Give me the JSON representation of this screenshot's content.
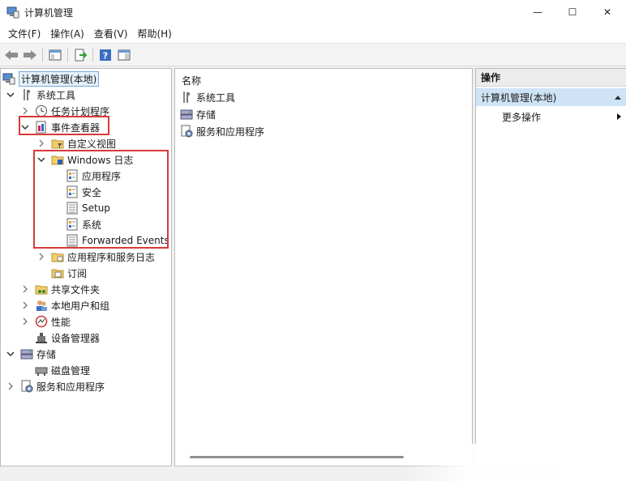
{
  "window": {
    "title": "计算机管理",
    "minimize": "—",
    "maximize": "☐",
    "close": "✕"
  },
  "menu": [
    "文件(F)",
    "操作(A)",
    "查看(V)",
    "帮助(H)"
  ],
  "tree": {
    "root": "计算机管理(本地)",
    "system_tools": "系统工具",
    "task_scheduler": "任务计划程序",
    "event_viewer": "事件查看器",
    "custom_views": "自定义视图",
    "windows_logs": "Windows 日志",
    "application": "应用程序",
    "security": "安全",
    "setup": "Setup",
    "system": "系统",
    "forwarded_events": "Forwarded Events",
    "app_service_logs": "应用程序和服务日志",
    "subscriptions": "订阅",
    "shared_folders": "共享文件夹",
    "local_users": "本地用户和组",
    "performance": "性能",
    "device_manager": "设备管理器",
    "storage": "存储",
    "disk_management": "磁盘管理",
    "services_apps": "服务和应用程序"
  },
  "middle": {
    "column_header": "名称",
    "items": [
      "系统工具",
      "存储",
      "服务和应用程序"
    ]
  },
  "actions": {
    "header": "操作",
    "group": "计算机管理(本地)",
    "more": "更多操作"
  },
  "colors": {
    "highlight_box": "#d93a3a",
    "selected_bg": "#e5f1fb",
    "actions_group_bg": "#cfe3f6"
  }
}
